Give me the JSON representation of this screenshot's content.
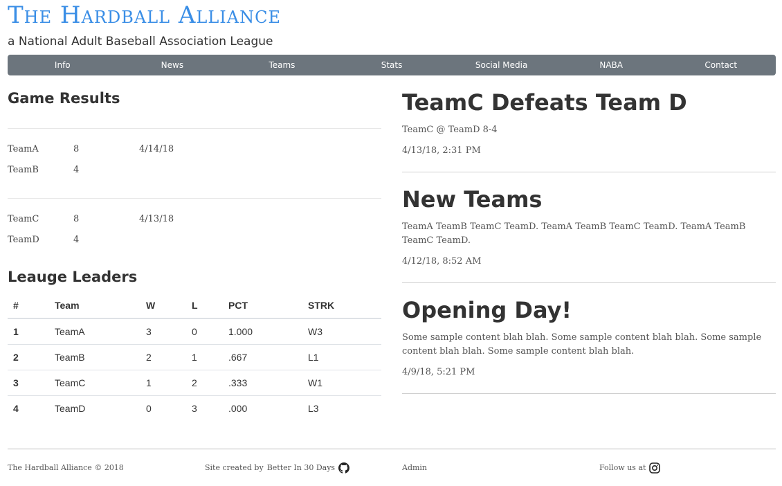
{
  "header": {
    "title": "The Hardball Alliance",
    "subtitle": "a National Adult Baseball Association League"
  },
  "nav": {
    "items": [
      {
        "label": "Info"
      },
      {
        "label": "News"
      },
      {
        "label": "Teams"
      },
      {
        "label": "Stats"
      },
      {
        "label": "Social Media"
      },
      {
        "label": "NABA"
      },
      {
        "label": "Contact"
      }
    ]
  },
  "game_results": {
    "title": "Game Results",
    "games": [
      {
        "date": "4/14/18",
        "teams": [
          {
            "name": "TeamA",
            "score": "8"
          },
          {
            "name": "TeamB",
            "score": "4"
          }
        ]
      },
      {
        "date": "4/13/18",
        "teams": [
          {
            "name": "TeamC",
            "score": "8"
          },
          {
            "name": "TeamD",
            "score": "4"
          }
        ]
      }
    ]
  },
  "leaders": {
    "title": "Leauge Leaders",
    "columns": [
      "#",
      "Team",
      "W",
      "L",
      "PCT",
      "STRK"
    ],
    "rows": [
      [
        "1",
        "TeamA",
        "3",
        "0",
        "1.000",
        "W3"
      ],
      [
        "2",
        "TeamB",
        "2",
        "1",
        ".667",
        "L1"
      ],
      [
        "3",
        "TeamC",
        "1",
        "2",
        ".333",
        "W1"
      ],
      [
        "4",
        "TeamD",
        "0",
        "3",
        ".000",
        "L3"
      ]
    ]
  },
  "posts": [
    {
      "title": "TeamC Defeats Team D",
      "body": "TeamC @ TeamD 8-4",
      "date": "4/13/18, 2:31 PM"
    },
    {
      "title": "New Teams",
      "body": "TeamA TeamB TeamC TeamD. TeamA TeamB TeamC TeamD. TeamA TeamB TeamC TeamD.",
      "date": "4/12/18, 8:52 AM"
    },
    {
      "title": "Opening Day!",
      "body": "Some sample content blah blah. Some sample content blah blah. Some sample content blah blah. Some sample content blah blah.",
      "date": "4/9/18, 5:21 PM"
    }
  ],
  "footer": {
    "copyright": "The Hardball Alliance © 2018",
    "credit_prefix": "Site created by",
    "credit_name": "Better In 30 Days",
    "credit_icon": "github-icon",
    "admin": "Admin",
    "follow": "Follow us at",
    "follow_icon": "instagram-icon"
  },
  "colors": {
    "brand": "#3a8ee6",
    "nav_bg": "#6c757d"
  }
}
